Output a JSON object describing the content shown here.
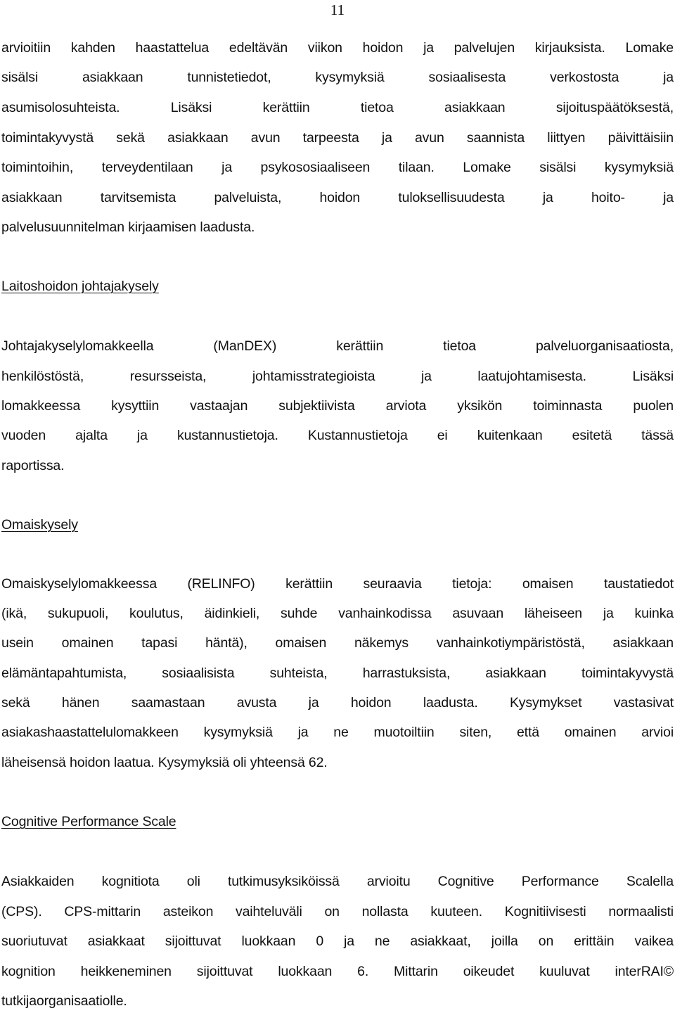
{
  "page_number": "11",
  "sections": [
    {
      "heading": null,
      "lines": [
        "arvioitiin kahden haastattelua edeltävän viikon hoidon ja palvelujen kirjauksista. Lomake",
        "sisälsi asiakkaan tunnistetiedot, kysymyksiä sosiaalisesta verkostosta ja",
        "asumisolosuhteista. Lisäksi kerättiin tietoa asiakkaan sijoituspäätöksestä,",
        "toimintakyvystä sekä asiakkaan avun tarpeesta ja avun saannista liittyen päivittäisiin",
        "toimintoihin, terveydentilaan ja psykososiaaliseen tilaan. Lomake sisälsi kysymyksiä",
        "asiakkaan tarvitsemista palveluista, hoidon tuloksellisuudesta ja hoito- ja",
        "palvelusuunnitelman kirjaamisen laadusta."
      ]
    },
    {
      "heading": "Laitoshoidon johtajakysely",
      "lines": [
        "Johtajakyselylomakkeella (ManDEX) kerättiin tietoa palveluorganisaatiosta,",
        "henkilöstöstä, resursseista, johtamisstrategioista ja laatujohtamisesta. Lisäksi",
        "lomakkeessa kysyttiin vastaajan subjektiivista arviota yksikön toiminnasta puolen",
        "vuoden ajalta ja kustannustietoja. Kustannustietoja ei kuitenkaan esitetä tässä",
        "raportissa."
      ]
    },
    {
      "heading": "Omaiskysely",
      "lines": [
        "Omaiskyselylomakkeessa (RELINFO) kerättiin seuraavia tietoja: omaisen taustatiedot",
        "(ikä, sukupuoli, koulutus, äidinkieli, suhde vanhainkodissa asuvaan läheiseen ja kuinka",
        "usein omainen tapasi häntä), omaisen näkemys vanhainkotiympäristöstä, asiakkaan",
        "elämäntapahtumista, sosiaalisista suhteista, harrastuksista, asiakkaan toimintakyvystä",
        "sekä hänen saamastaan avusta ja hoidon laadusta. Kysymykset vastasivat",
        "asiakashaastattelulomakkeen kysymyksiä ja ne muotoiltiin siten, että omainen arvioi",
        "läheisensä hoidon laatua. Kysymyksiä oli yhteensä 62."
      ]
    },
    {
      "heading": "Cognitive Performance Scale",
      "lines": [
        "Asiakkaiden kognitiota oli tutkimusyksiköissä arvioitu Cognitive Performance Scalella",
        "(CPS). CPS-mittarin asteikon vaihteluväli on nollasta kuuteen. Kognitiivisesti normaalisti",
        "suoriutuvat asiakkaat sijoittuvat luokkaan 0 ja ne asiakkaat, joilla on erittäin vaikea",
        "kognition heikkeneminen sijoittuvat luokkaan 6. Mittarin oikeudet kuuluvat interRAI©",
        "tutkijaorganisaatiolle."
      ]
    }
  ]
}
